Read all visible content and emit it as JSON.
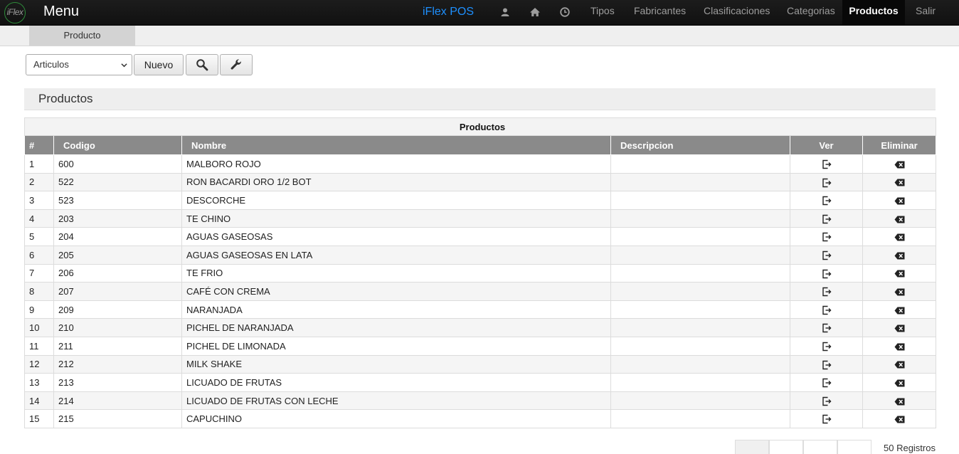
{
  "header": {
    "logo_text": "iFlex",
    "menu_title": "Menu",
    "brand": "iFlex POS",
    "icons": [
      "user-icon",
      "home-icon",
      "clock-icon"
    ],
    "nav": [
      {
        "label": "Tipos"
      },
      {
        "label": "Fabricantes"
      },
      {
        "label": "Clasificaciones"
      },
      {
        "label": "Categorias"
      },
      {
        "label": "Productos",
        "active": true
      },
      {
        "label": "Salir"
      }
    ]
  },
  "subnav": {
    "tab": "Producto"
  },
  "toolbar": {
    "select_value": "Articulos",
    "new_label": "Nuevo",
    "search_icon": "search-icon",
    "tools_icon": "wrench-icon"
  },
  "panel": {
    "title": "Productos"
  },
  "table": {
    "caption": "Productos",
    "columns": [
      "#",
      "Codigo",
      "Nombre",
      "Descripcion",
      "Ver",
      "Eliminar"
    ],
    "rows": [
      {
        "n": "1",
        "codigo": "600",
        "nombre": "MALBORO ROJO",
        "descripcion": ""
      },
      {
        "n": "2",
        "codigo": "522",
        "nombre": "RON BACARDI ORO 1/2 BOT",
        "descripcion": ""
      },
      {
        "n": "3",
        "codigo": "523",
        "nombre": "DESCORCHE",
        "descripcion": ""
      },
      {
        "n": "4",
        "codigo": "203",
        "nombre": "TE CHINO",
        "descripcion": ""
      },
      {
        "n": "5",
        "codigo": "204",
        "nombre": "AGUAS GASEOSAS",
        "descripcion": ""
      },
      {
        "n": "6",
        "codigo": "205",
        "nombre": "AGUAS GASEOSAS EN LATA",
        "descripcion": ""
      },
      {
        "n": "7",
        "codigo": "206",
        "nombre": "TE FRIO",
        "descripcion": ""
      },
      {
        "n": "8",
        "codigo": "207",
        "nombre": "CAFÉ CON CREMA",
        "descripcion": ""
      },
      {
        "n": "9",
        "codigo": "209",
        "nombre": "NARANJADA",
        "descripcion": ""
      },
      {
        "n": "10",
        "codigo": "210",
        "nombre": "PICHEL DE NARANJADA",
        "descripcion": ""
      },
      {
        "n": "11",
        "codigo": "211",
        "nombre": "PICHEL DE LIMONADA",
        "descripcion": ""
      },
      {
        "n": "12",
        "codigo": "212",
        "nombre": "MILK SHAKE",
        "descripcion": ""
      },
      {
        "n": "13",
        "codigo": "213",
        "nombre": "LICUADO DE FRUTAS",
        "descripcion": ""
      },
      {
        "n": "14",
        "codigo": "214",
        "nombre": "LICUADO DE FRUTAS CON LECHE",
        "descripcion": ""
      },
      {
        "n": "15",
        "codigo": "215",
        "nombre": "CAPUCHINO",
        "descripcion": ""
      }
    ],
    "view_icon": "view-exit-icon",
    "delete_icon": "backspace-delete-icon"
  },
  "footer": {
    "records": "50 Registros"
  },
  "colors": {
    "accent": "#1e90ff",
    "nav_bg": "#1c1c1c",
    "table_header": "#8a8a8a"
  }
}
